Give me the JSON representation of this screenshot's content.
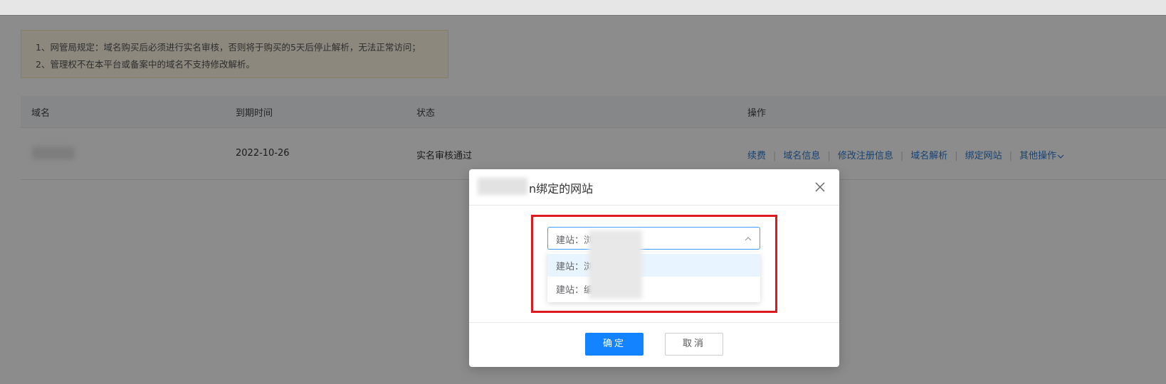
{
  "notice": {
    "line1": "1、网管局规定：域名购买后必须进行实名审核，否则将于购买的5天后停止解析，无法正常访问；",
    "line2": "2、管理权不在本平台或备案中的域名不支持修改解析。"
  },
  "table": {
    "headers": [
      "域名",
      "到期时间",
      "状态",
      "操作"
    ],
    "row": {
      "expiry": "2022-10-26",
      "status": "实名审核通过",
      "operations": [
        "续费",
        "域名信息",
        "修改注册信息",
        "域名解析",
        "绑定网站",
        "其他操作"
      ]
    }
  },
  "modal": {
    "title": "n绑定的网站",
    "select_value": "建站：浏",
    "options": [
      "建站：浏",
      "建站：编"
    ],
    "confirm": "确定",
    "cancel": "取消"
  },
  "colors": {
    "link": "#2d7bd6",
    "primary": "#1383ff",
    "highlight": "#e0181f"
  }
}
